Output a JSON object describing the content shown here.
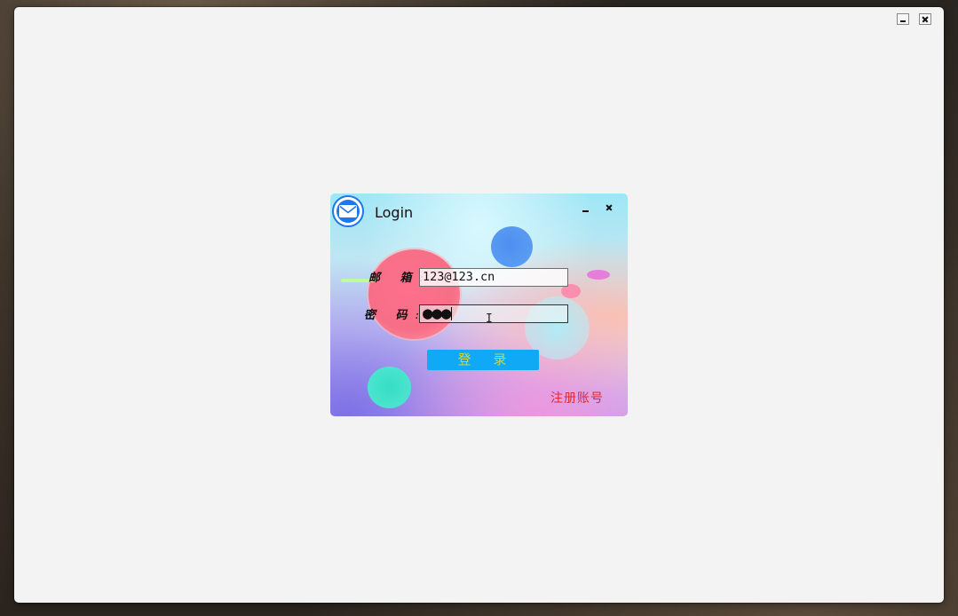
{
  "outer_window": {
    "controls": [
      "minimize-icon",
      "close-icon"
    ]
  },
  "login": {
    "title": "Login",
    "email_label": "邮 箱",
    "email_value": "123@123.cn",
    "password_label": "密 码",
    "password_masked": "●●●",
    "submit_label": "登 录",
    "register_label": "注册账号"
  },
  "colors": {
    "window_bg": "#f3f3f3",
    "button_bg": "#0fa9f5",
    "button_text": "#c9d64a",
    "register_text": "#e2292c",
    "logo_blue": "#1d78e8"
  }
}
